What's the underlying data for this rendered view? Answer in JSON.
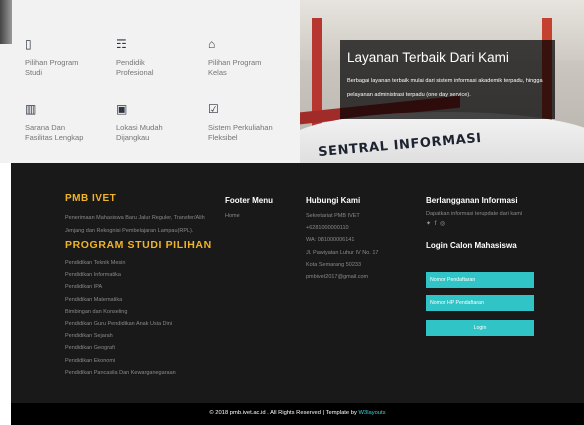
{
  "features": [
    {
      "icon": "book-icon",
      "glyph": "▯",
      "label": "Pilihan Program\nStudi"
    },
    {
      "icon": "users-icon",
      "glyph": "☶",
      "label": "Pendidik\nProfesional"
    },
    {
      "icon": "graduation-cap-icon",
      "glyph": "⌂",
      "label": "Pilihan Program\nKelas"
    },
    {
      "icon": "building-icon",
      "glyph": "▥",
      "label": "Sarana Dan\nFasilitas Lengkap"
    },
    {
      "icon": "bus-icon",
      "glyph": "▣",
      "label": "Lokasi Mudah\nDijangkau"
    },
    {
      "icon": "calendar-check-icon",
      "glyph": "☑",
      "label": "Sistem Perkuliahan\nFleksibel"
    }
  ],
  "hero": {
    "title": "Layanan Terbaik Dari Kami",
    "text": "Berbagai layanan terbaik mulai dari sistem informasi akademik terpadu, hingga pelayanan administrasi terpadu (one day service).",
    "sign": "SENTRAL INFORMASI"
  },
  "footer": {
    "brand": "PMB IVET",
    "brand_text": "Penerimaan Mahasiswa Baru Jalur Reguler, Transfer/Alih Jenjang dan Rekognisi Pembelajaran Lampau(RPL).",
    "programs_title": "PROGRAM STUDI PILIHAN",
    "programs": [
      "Pendidikan Teknik Mesin",
      "Pendidikan Informatika",
      "Pendidikan IPA",
      "Pendidikan Matematika",
      "Bimbingan dan Konseling",
      "Pendidikan Guru Pendidikan Anak Usia Dini",
      "Pendidikan Sejarah",
      "Pendidikan Geografi",
      "Pendidikan Ekonomi",
      "Pendidikan Pancasila Dan Kewarganegaraan"
    ],
    "menu_title": "Footer Menu",
    "menu_items": [
      "Home"
    ],
    "contact_title": "Hubungi Kami",
    "contact_lines": [
      "Sekretariat PMB IVET",
      "+6281000000110",
      "WA: 081000006141",
      "Jl. Pawiyatan Luhur IV No. 17",
      "Kota Semarang 50233",
      "pmbivet2017@gmail.com"
    ],
    "subscribe_title": "Berlangganan Informasi",
    "subscribe_text": "Dapatkan informasi terupdate dari kami",
    "social": "✦ f ◎",
    "login_title": "Login Calon Mahasiswa",
    "login_user_placeholder": "Nomor Pendaftaran",
    "login_pass_placeholder": "Nomor HP Pendaftaran",
    "login_button": "Login",
    "copyright": "© 2018 pmb.ivet.ac.id . All Rights Reserved | Template by",
    "template_by": "W3layouts"
  },
  "colors": {
    "accent_gold": "#f0b428",
    "accent_teal": "#31c4c6",
    "footer_bg": "#191919"
  }
}
